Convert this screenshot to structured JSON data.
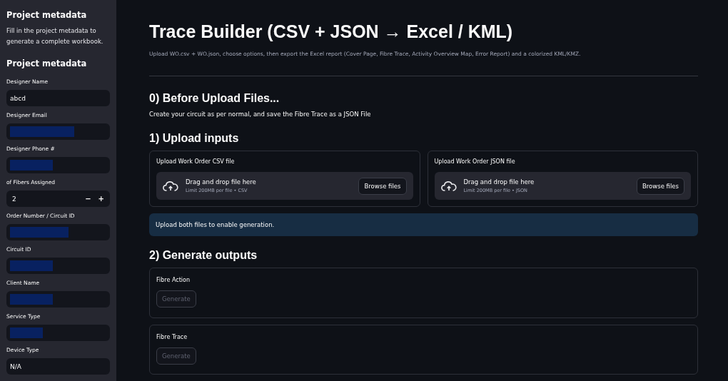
{
  "sidebar": {
    "title": "Project metadata",
    "description": "Fill in the project metadata to generate a complete workbook.",
    "heading": "Project metadata",
    "fields": [
      {
        "kind": "text",
        "label": "Designer Name",
        "value": "abcd"
      },
      {
        "kind": "redacted",
        "label": "Designer Email"
      },
      {
        "kind": "redacted",
        "label": "Designer Phone #"
      },
      {
        "kind": "number",
        "label": "of Fibers Assigned",
        "value": "2",
        "minus": "−",
        "plus": "+"
      },
      {
        "kind": "redacted",
        "label": "Order Number / Circuit ID"
      },
      {
        "kind": "redacted",
        "label": "Circuit ID"
      },
      {
        "kind": "redacted",
        "label": "Client Name"
      },
      {
        "kind": "redacted",
        "label": "Service Type"
      },
      {
        "kind": "text",
        "label": "Device Type",
        "value": "N/A"
      }
    ]
  },
  "main": {
    "title": "Trace Builder (CSV + JSON → Excel / KML)",
    "subtitle": "Upload WO.csv + WO.json, choose options, then export the Excel report (Cover Page, Fibre Trace, Activity Overview Map, Error Report) and a colorized KML/KMZ.",
    "sections": [
      {
        "kind": "text",
        "heading": "0) Before Upload Files...",
        "text": "Create your circuit as per normal, and save the Fibre Trace as a JSON File"
      },
      {
        "kind": "uploads",
        "heading": "1) Upload inputs",
        "uploaders": [
          {
            "label": "Upload Work Order CSV file",
            "drop": "Drag and drop file here",
            "limit": "Limit 200MB per file • CSV",
            "button": "Browse files"
          },
          {
            "label": "Upload Work Order JSON file",
            "drop": "Drag and drop file here",
            "limit": "Limit 200MB per file • JSON",
            "button": "Browse files"
          }
        ],
        "info": "Upload both files to enable generation."
      },
      {
        "kind": "outputs",
        "heading": "2) Generate outputs",
        "outputs": [
          {
            "label": "Fibre Action",
            "button": "Generate",
            "disabled": true
          },
          {
            "label": "Fibre Trace",
            "button": "Generate",
            "disabled": true
          }
        ]
      }
    ]
  }
}
